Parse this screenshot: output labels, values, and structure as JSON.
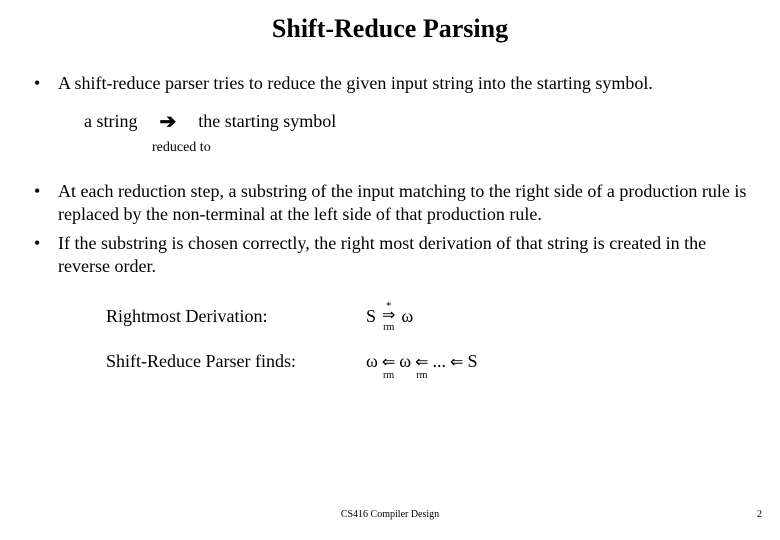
{
  "title": "Shift-Reduce Parsing",
  "bullets": {
    "b0": "A shift-reduce parser tries to reduce the given input string into the starting symbol.",
    "b1": "At each reduction step, a substring of the input matching to the right side of a production rule is replaced by the non-terminal at the left side of that production rule.",
    "b2": "If the substring is chosen correctly, the right most derivation of that string is created in the reverse order."
  },
  "reduction": {
    "lhs": "a string",
    "arrow": "➔",
    "rhs": "the starting symbol",
    "caption": "reduced to"
  },
  "deriv": {
    "rightmost_label": "Rightmost Derivation:",
    "rightmost_S": "S",
    "rightmost_star": "*",
    "rightmost_arrow": "⇒",
    "rightmost_sub": "rm",
    "rightmost_omega": "ω",
    "sr_label": "Shift-Reduce Parser finds:",
    "sr_omega": "ω",
    "sr_left_arrow": "⇐",
    "sr_sub": "rm",
    "sr_dots": " ... ",
    "sr_S": "S"
  },
  "footer": {
    "center": "CS416 Compiler Design",
    "page": "2"
  }
}
